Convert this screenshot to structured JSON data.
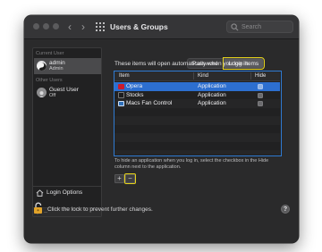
{
  "window": {
    "title": "Users & Groups",
    "search_placeholder": "Search"
  },
  "sidebar": {
    "current_user_label": "Current User",
    "current_user": {
      "name": "admin",
      "role": "Admin"
    },
    "other_users_label": "Other Users",
    "other_users": [
      {
        "name": "Guest User",
        "role": "Off"
      }
    ],
    "login_options_label": "Login Options",
    "add_label": "+",
    "remove_label": "−"
  },
  "tabs": [
    {
      "label": "Password",
      "selected": false
    },
    {
      "label": "Login Items",
      "selected": true
    }
  ],
  "login_items": {
    "description": "These items will open automatically when you log in:",
    "columns": {
      "item": "Item",
      "kind": "Kind",
      "hide": "Hide"
    },
    "rows": [
      {
        "name": "Opera",
        "kind": "Application",
        "hide": false,
        "selected": true,
        "icon": "opera-icon",
        "icon_color": "#cc1b2c"
      },
      {
        "name": "Stocks",
        "kind": "Application",
        "hide": false,
        "selected": false,
        "icon": "stocks-icon",
        "icon_color": "#1c1c1e"
      },
      {
        "name": "Macs Fan Control",
        "kind": "Application",
        "hide": false,
        "selected": false,
        "icon": "fan-control-icon",
        "icon_color": "#2f6fb8"
      }
    ],
    "hint": "To hide an application when you log in, select the checkbox in the Hide column next to the application.",
    "add_label": "+",
    "remove_label": "−"
  },
  "footer": {
    "lock_text": "Click the lock to prevent further changes.",
    "help_label": "?"
  },
  "colors": {
    "selection": "#2d6fd0",
    "highlight_outline": "#e6d31a",
    "window_bg": "#2a2a2b"
  }
}
